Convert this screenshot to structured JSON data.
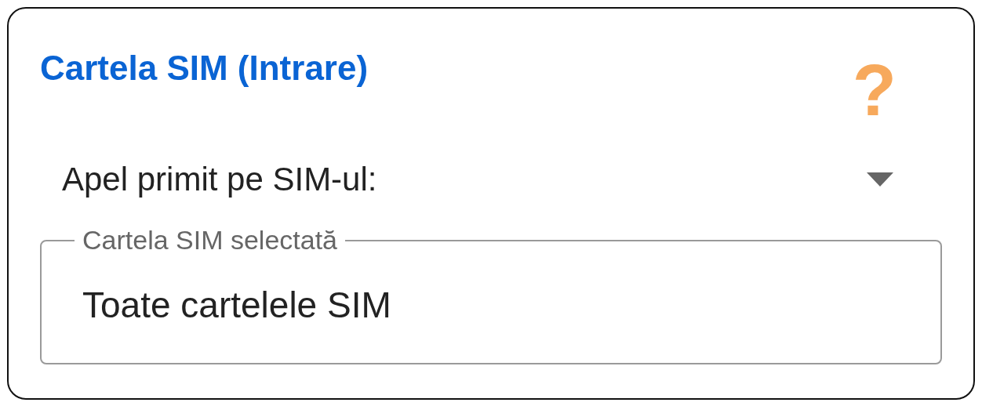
{
  "card": {
    "title": "Cartela SIM (Intrare)",
    "help": "?",
    "dropdown": {
      "label": "Apel primit pe SIM-ul:"
    },
    "field": {
      "label": "Cartela SIM selectată",
      "value": "Toate cartelele SIM"
    }
  }
}
